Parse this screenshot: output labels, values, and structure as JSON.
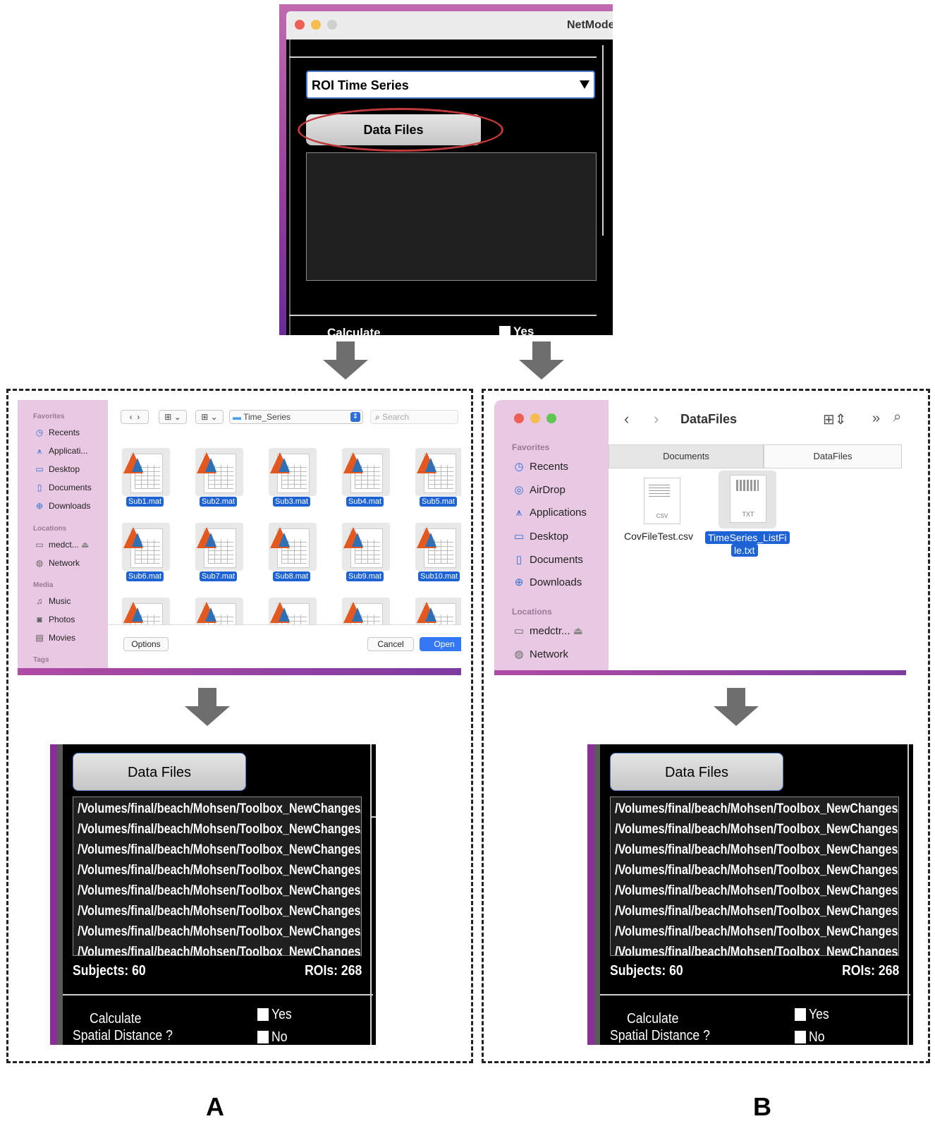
{
  "top_window": {
    "title": "NetModel",
    "dropdown_value": "ROI Time Series",
    "data_files_button": "Data Files",
    "calculate_label": "Calculate",
    "yes_label": "Yes"
  },
  "dialog_a": {
    "sidebar": {
      "favorites_header": "Favorites",
      "favorites": [
        "Recents",
        "Applicati...",
        "Desktop",
        "Documents",
        "Downloads"
      ],
      "locations_header": "Locations",
      "locations": [
        "medct...",
        "Network"
      ],
      "media_header": "Media",
      "media": [
        "Music",
        "Photos",
        "Movies"
      ],
      "tags_header": "Tags"
    },
    "toolbar": {
      "folder": "Time_Series",
      "search_placeholder": "Search"
    },
    "files_row1": [
      "Sub1.mat",
      "Sub2.mat",
      "Sub3.mat",
      "Sub4.mat",
      "Sub5.mat"
    ],
    "files_row2": [
      "Sub6.mat",
      "Sub7.mat",
      "Sub8.mat",
      "Sub9.mat",
      "Sub10.mat"
    ],
    "options_button": "Options",
    "cancel_button": "Cancel",
    "open_button": "Open"
  },
  "dialog_b": {
    "title": "DataFiles",
    "tabs": [
      "Documents",
      "DataFiles"
    ],
    "sidebar": {
      "favorites_header": "Favorites",
      "favorites": [
        "Recents",
        "AirDrop",
        "Applications",
        "Desktop",
        "Documents",
        "Downloads"
      ],
      "locations_header": "Locations",
      "locations": [
        "medctr...",
        "Network"
      ]
    },
    "files": [
      {
        "name": "CovFileTest.csv",
        "type": "CSV"
      },
      {
        "name_line1": "TimeSeries_ListFi",
        "name_line2": "le.txt",
        "type": "TXT"
      }
    ]
  },
  "result": {
    "data_files_button": "Data Files",
    "paths": [
      "/Volumes/final/beach/Mohsen/Toolbox_NewChanges/",
      "/Volumes/final/beach/Mohsen/Toolbox_NewChanges/",
      "/Volumes/final/beach/Mohsen/Toolbox_NewChanges/",
      "/Volumes/final/beach/Mohsen/Toolbox_NewChanges/",
      "/Volumes/final/beach/Mohsen/Toolbox_NewChanges/",
      "/Volumes/final/beach/Mohsen/Toolbox_NewChanges/",
      "/Volumes/final/beach/Mohsen/Toolbox_NewChanges/",
      "/Volumes/final/beach/Mohsen/Toolbox_NewChanges/"
    ],
    "subjects": "Subjects: 60",
    "rois": "ROIs: 268",
    "calculate_line1": "Calculate",
    "calculate_line2": "Spatial Distance ?",
    "yes_label": "Yes",
    "no_label": "No"
  },
  "labels": {
    "a": "A",
    "b": "B"
  },
  "colors": {
    "selection": "#1e63d6",
    "highlight_ellipse": "#c0393b",
    "arrow": "#6e6e6e"
  }
}
